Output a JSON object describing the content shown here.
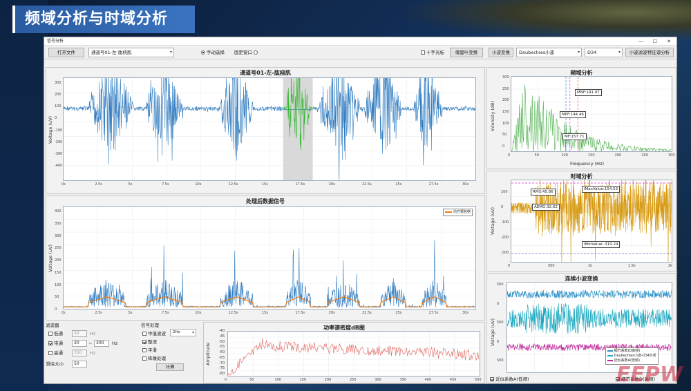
{
  "slide": {
    "title": "频域分析与时域分析"
  },
  "window": {
    "title": "信号分析"
  },
  "toolbar": {
    "open_file": "打开文件",
    "channel_select": "通道号01-左-肱桡肌",
    "manual_select": "手动选择",
    "fixed_window": "固定窗口",
    "crosshair": "十字光标",
    "fft": "傅里叶变换",
    "wavelet": "小波变换",
    "wavelet_family": "Daubechies小波",
    "wavelet_order": "D34",
    "wavelet_analysis": "小波滤波特征谱分析"
  },
  "raw_plot": {
    "title": "通道号01-左-肱桡肌",
    "ylabel": "Voltage (uV)",
    "yticks": [
      "300",
      "200",
      "100",
      "0",
      "-100",
      "-200",
      "-300",
      "-400"
    ],
    "xticks": [
      "0s",
      "2.5s",
      "5s",
      "7.5s",
      "10s",
      "12.5s",
      "15s",
      "17.5s",
      "20s",
      "22.5s",
      "25s",
      "27.5s",
      "30s"
    ]
  },
  "proc_plot": {
    "title": "处理后数据信号",
    "ylabel": "Voltage (uV)",
    "legend": "均方根包络",
    "yticks": [
      "400",
      "350",
      "300",
      "250",
      "200",
      "150",
      "100",
      "50",
      "0"
    ],
    "xticks": [
      "0s",
      "2.5s",
      "5s",
      "7.5s",
      "10s",
      "12.5s",
      "15s",
      "17.5s",
      "20s",
      "22.5s",
      "25s",
      "27.5s",
      "30s"
    ]
  },
  "filter": {
    "group": "滤波器",
    "lowpass": "低通",
    "lowpass_val": "30",
    "bandpass": "带通",
    "bandpass_low": "30",
    "bandpass_high": "300",
    "highpass": "高通",
    "highpass_val": "350",
    "unit": "Hz",
    "tilde": "~",
    "window_size_label": "滑块大小",
    "window_size": "50"
  },
  "signal_proc": {
    "group": "信号处理",
    "notch": "中值滤波",
    "notch_freq": "2Hz",
    "rectify": "整流",
    "smooth": "平滑",
    "detrend": "降噪处理",
    "compute": "计算"
  },
  "psd_plot": {
    "title": "功率谱密度dB图",
    "ylabel": "Amplitude",
    "yticks": [
      "-40",
      "-45",
      "-50",
      "-55",
      "-60",
      "-65",
      "-70",
      "-75",
      "-80"
    ],
    "xticks": [
      "0",
      "50",
      "100",
      "150",
      "200",
      "250",
      "300",
      "350",
      "400",
      "450",
      "500"
    ]
  },
  "freq_plot": {
    "title": "频域分析",
    "ylabel": "Intensity (dB)",
    "xlabel": "Frequency (Hz)",
    "mnf": "MNF:191.97",
    "mpf": "MPF:144.46",
    "mf": "MF:157.71",
    "yticks": [
      "300",
      "250",
      "200",
      "150",
      "100",
      "50",
      "0"
    ],
    "xticks": [
      "0",
      "50",
      "100",
      "150",
      "200",
      "250",
      "300"
    ]
  },
  "time_plot": {
    "title": "时域分析",
    "ylabel": "Voltage (uV)",
    "rms": "RMS:45.86",
    "aemg": "AEMG:32.62",
    "max": "iMaxValue:154.53",
    "min": "iMinValue:-310.24",
    "yticks": [
      "100",
      "0",
      "-100",
      "-200",
      "-300"
    ],
    "xticks": [
      "0",
      "500",
      "1k",
      "1.5k",
      "2k"
    ]
  },
  "wavelet_plot": {
    "title": "连续小波变换",
    "ylabel": "Voltage (uV)",
    "legend": [
      "细节系数(D高频)",
      "Daubechies小波-D34分析",
      "近似系数A(低频)"
    ],
    "yticks": [
      "500",
      "0",
      "500",
      "0",
      "500"
    ],
    "show_approx": "近似系数A(低频)",
    "show_detail": "细节系数D(高频)"
  },
  "watermark": "EEPW",
  "colors": {
    "raw": "#2f7bbf",
    "highlight": "#2fb52f",
    "envelope": "#f07a10",
    "freq": "#4cae4c",
    "time": "#d69a12",
    "psd": "#e0605a",
    "wave1": "#2a8fc4",
    "wave2": "#1aa8c0",
    "wave3": "#c02a9a"
  }
}
